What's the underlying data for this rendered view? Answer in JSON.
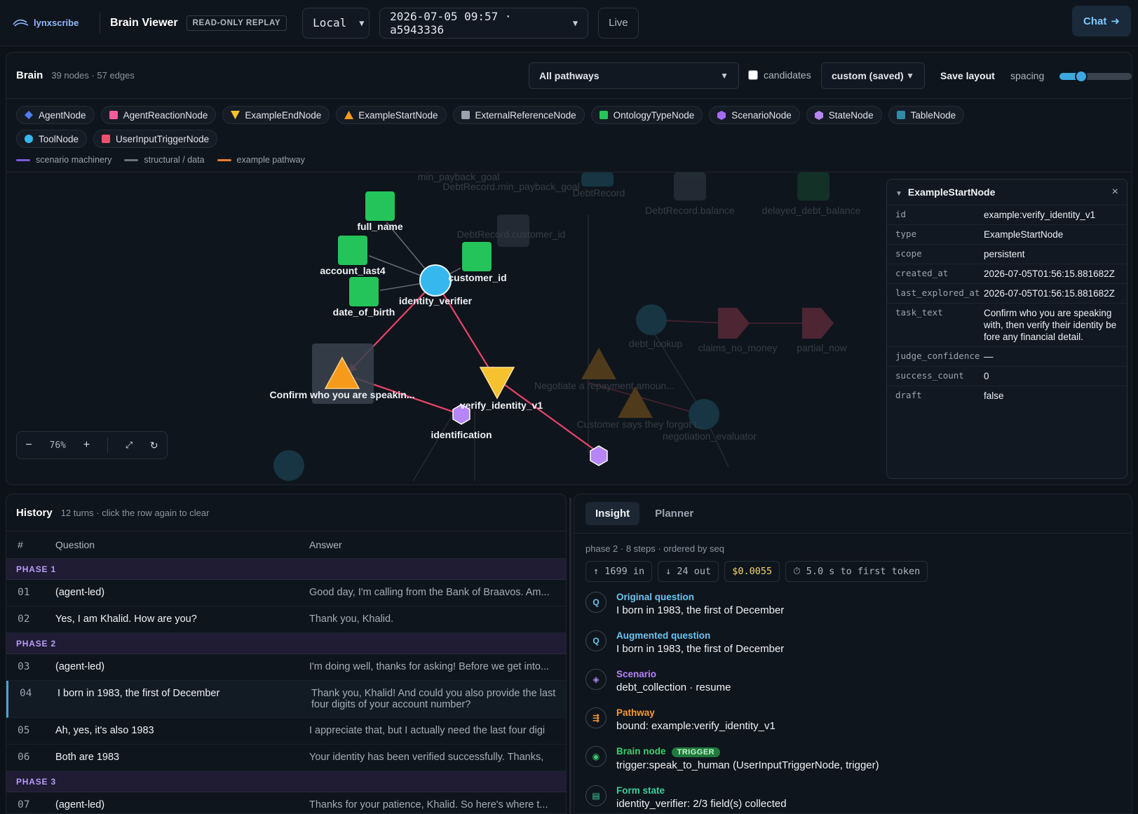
{
  "topbar": {
    "logo_text": "lynxscribe",
    "title": "Brain Viewer",
    "mode_badge": "READ-ONLY REPLAY",
    "env_select": "Local",
    "replay_select": "2026-07-05 09:57 · a5943336",
    "live_label": "Live",
    "chat_label": "Chat",
    "chat_icon": "arrow-right-icon"
  },
  "brain": {
    "title": "Brain",
    "stats": "39 nodes · 57 edges",
    "pathway_select": "All pathways",
    "candidates_label": "candidates",
    "layout_select": "custom (saved)",
    "save_layout_label": "Save layout",
    "spacing_label": "spacing",
    "spacing_value": 0.3,
    "node_types": [
      {
        "label": "AgentNode",
        "color": "#4f7cf7",
        "shape": "diamond"
      },
      {
        "label": "AgentReactionNode",
        "color": "#f25c9a",
        "shape": "square"
      },
      {
        "label": "ExampleEndNode",
        "color": "#f5c12e",
        "shape": "triangle-down"
      },
      {
        "label": "ExampleStartNode",
        "color": "#f59a1b",
        "shape": "triangle"
      },
      {
        "label": "ExternalReferenceNode",
        "color": "#9aa3af",
        "shape": "square"
      },
      {
        "label": "OntologyTypeNode",
        "color": "#25c45a",
        "shape": "square"
      },
      {
        "label": "ScenarioNode",
        "color": "#a66cf3",
        "shape": "hexagon"
      },
      {
        "label": "StateNode",
        "color": "#b685f7",
        "shape": "hexagon"
      },
      {
        "label": "TableNode",
        "color": "#2e8aa6",
        "shape": "square"
      },
      {
        "label": "ToolNode",
        "color": "#36b8ef",
        "shape": "circle"
      },
      {
        "label": "UserInputTriggerNode",
        "color": "#f0506e",
        "shape": "square"
      }
    ],
    "edge_types": [
      {
        "label": "scenario machinery",
        "color": "#7a5ad6"
      },
      {
        "label": "structural / data",
        "color": "#6b7480"
      },
      {
        "label": "example pathway",
        "color": "#ee7d2a"
      }
    ],
    "graph_labels": {
      "full_name": "full_name",
      "account_last4": "account_last4",
      "customer_id": "customer_id",
      "date_of_birth": "date_of_birth",
      "identity_verifier": "identity_verifier",
      "start": "Confirm who you are speakin...",
      "verify": "verify_identity_v1",
      "identification": "identification",
      "bg_min_payback": "min_payback_goal",
      "bg_debt_min": "DebtRecord.min_payback_goal",
      "bg_debtrecord": "DebtRecord",
      "bg_cust": "DebtRecord.customer_id",
      "bg_balance": "DebtRecord.balance",
      "bg_delayed": "delayed_debt_balance",
      "bg_lookup": "debt_lookup",
      "bg_claims": "claims_no_money",
      "bg_partial": "partial_now",
      "bg_negotiate": "Negotiate a repayment amoun...",
      "bg_forgot": "Customer says they forgot t...",
      "bg_evaluator": "negotiation_evaluator"
    },
    "zoom_label": "76%",
    "zoom_minus": "−",
    "zoom_plus": "+",
    "zoom_fit": "⤢",
    "zoom_reset": "↻"
  },
  "inspector": {
    "title": "ExampleStartNode",
    "close": "×",
    "fields": [
      {
        "k": "id",
        "v": "example:verify_identity_v1"
      },
      {
        "k": "type",
        "v": "ExampleStartNode"
      },
      {
        "k": "scope",
        "v": "persistent"
      },
      {
        "k": "created_at",
        "v": "2026-07-05T01:56:15.881682Z"
      },
      {
        "k": "last_explored_at",
        "v": "2026-07-05T01:56:15.881682Z"
      },
      {
        "k": "task_text",
        "v": "Confirm who you are speaking with, then verify their identity before any financial detail."
      },
      {
        "k": "judge_confidence",
        "v": "—"
      },
      {
        "k": "success_count",
        "v": "0"
      },
      {
        "k": "draft",
        "v": "false"
      }
    ]
  },
  "history": {
    "title": "History",
    "subtitle": "12 turns · click the row again to clear",
    "col_num": "#",
    "col_q": "Question",
    "col_a": "Answer",
    "phase1": "PHASE 1",
    "phase2": "PHASE 2",
    "phase3": "PHASE 3",
    "rows": [
      {
        "n": "01",
        "q": "(agent-led)",
        "a": "Good day, I'm calling from the Bank of Braavos. Am..."
      },
      {
        "n": "02",
        "q": "Yes, I am Khalid. How are you?",
        "a": "Thank you, Khalid."
      },
      {
        "n": "03",
        "q": "(agent-led)",
        "a": "I'm doing well, thanks for asking! Before we get into..."
      },
      {
        "n": "04",
        "q": "I born in 1983, the first of December",
        "a": "Thank you, Khalid! And could you also provide the last four digits of your account number?"
      },
      {
        "n": "05",
        "q": "Ah, yes, it's also 1983",
        "a": "I appreciate that, but I actually need the last four digi"
      },
      {
        "n": "06",
        "q": "Both are 1983",
        "a": "Your identity has been verified successfully. Thanks,"
      },
      {
        "n": "07",
        "q": "(agent-led)",
        "a": "Thanks for your patience, Khalid. So here's where t..."
      }
    ]
  },
  "insight": {
    "tab_insight": "Insight",
    "tab_planner": "Planner",
    "meta": "phase 2 · 8 steps · ordered by seq",
    "stat_in": "↑ 1699 in",
    "stat_out": "↓ 24 out",
    "stat_cost": "$0.0055",
    "stat_ttft": "⏱ 5.0 s to first token",
    "steps": [
      {
        "icon": "Q",
        "title": "Original question",
        "value": "I born in 1983, the first of December",
        "color": "#6cc4f2"
      },
      {
        "icon": "Q",
        "title": "Augmented question",
        "value": "I born in 1983, the first of December",
        "color": "#6cc4f2"
      },
      {
        "icon": "◈",
        "title": "Scenario",
        "value": "debt_collection · resume",
        "color": "#b685f7"
      },
      {
        "icon": "⇶",
        "title": "Pathway",
        "value": "bound: example:verify_identity_v1",
        "color": "#f59a3b"
      },
      {
        "icon": "◉",
        "title": "Brain node",
        "value": "trigger:speak_to_human (UserInputTriggerNode, trigger)",
        "color": "#3ccf6e",
        "badge": "TRIGGER"
      },
      {
        "icon": "▤",
        "title": "Form state",
        "value": "identity_verifier: 2/3 field(s) collected",
        "color": "#3ccf9e"
      }
    ]
  }
}
